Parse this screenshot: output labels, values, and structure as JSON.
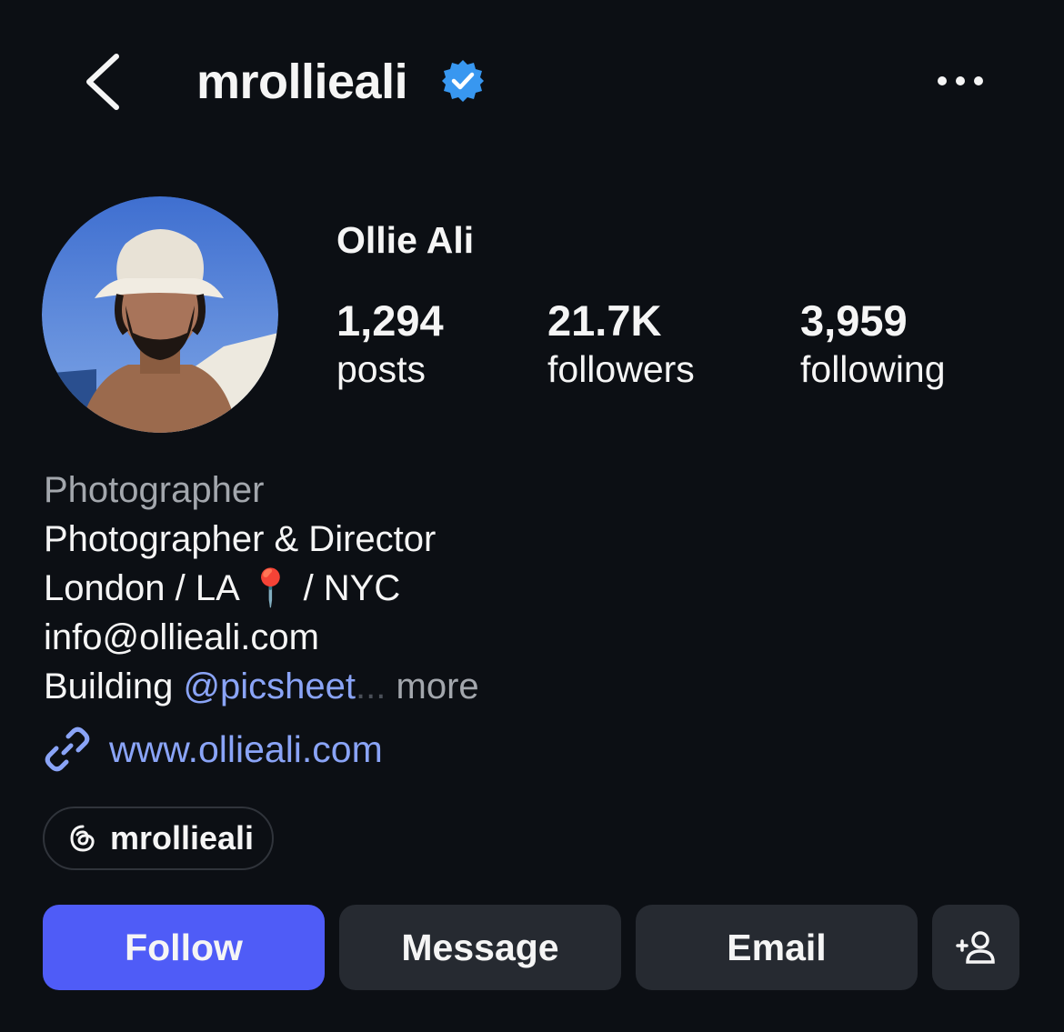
{
  "header": {
    "username": "mrollieali",
    "verified_color": "#3897f0"
  },
  "profile": {
    "display_name": "Ollie Ali",
    "stats": [
      {
        "value": "1,294",
        "label": "posts"
      },
      {
        "value": "21.7K",
        "label": "followers"
      },
      {
        "value": "3,959",
        "label": "following"
      }
    ]
  },
  "bio": {
    "category": "Photographer",
    "lines": [
      "Photographer & Director",
      "London / LA 📍 / NYC",
      "info@ollieali.com"
    ],
    "last_line_prefix": "Building ",
    "mention": "@picsheet",
    "ellipsis": "...",
    "more": "more",
    "website": "www.ollieali.com"
  },
  "threads": {
    "handle": "mrollieali"
  },
  "actions": {
    "follow": "Follow",
    "message": "Message",
    "email": "Email"
  },
  "colors": {
    "background": "#0c0f14",
    "accent": "#4f5cf7",
    "link": "#8aa4f7",
    "button_secondary": "#262a31"
  }
}
